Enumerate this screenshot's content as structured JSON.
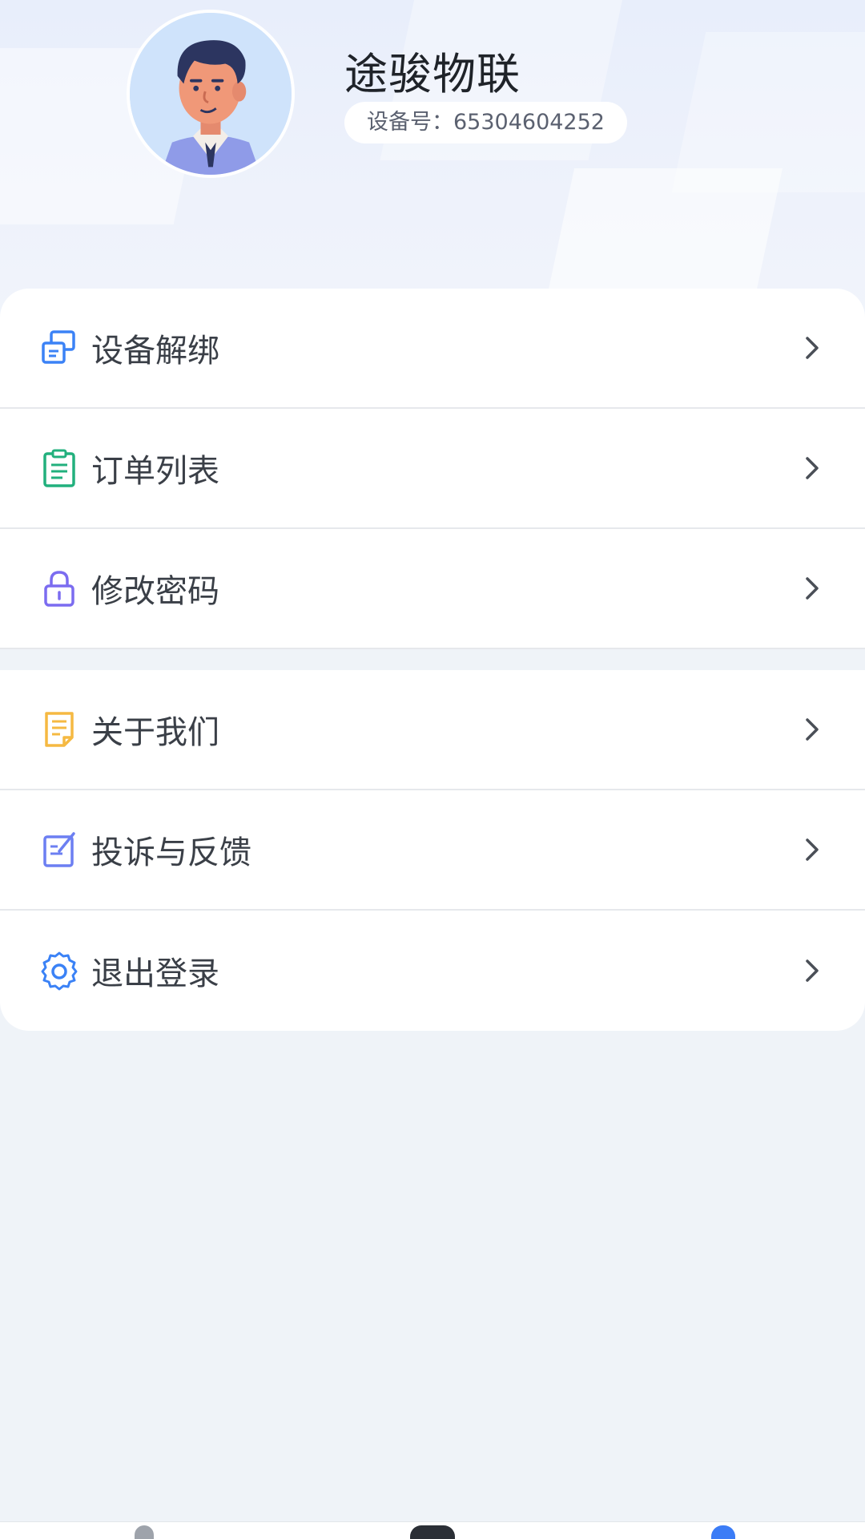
{
  "profile": {
    "app_name": "途骏物联",
    "device_label": "设备号：",
    "device_id": "65304604252"
  },
  "menu_group_1": [
    {
      "label": "设备解绑",
      "icon": "device-unbind-icon",
      "color": "#3b82f6"
    },
    {
      "label": "订单列表",
      "icon": "clipboard-list-icon",
      "color": "#22b07d"
    },
    {
      "label": "修改密码",
      "icon": "lock-icon",
      "color": "#7b6cf0"
    }
  ],
  "menu_group_2": [
    {
      "label": "关于我们",
      "icon": "document-icon",
      "color": "#f5b942"
    },
    {
      "label": "投诉与反馈",
      "icon": "edit-note-icon",
      "color": "#6c7ff2"
    },
    {
      "label": "退出登录",
      "icon": "gear-icon",
      "color": "#3b82f6"
    }
  ],
  "colors": {
    "background": "#eff3f8",
    "card": "#ffffff",
    "text_primary": "#1f2329",
    "chevron": "#4a4f57",
    "tab_active": "#3b7cf6"
  }
}
